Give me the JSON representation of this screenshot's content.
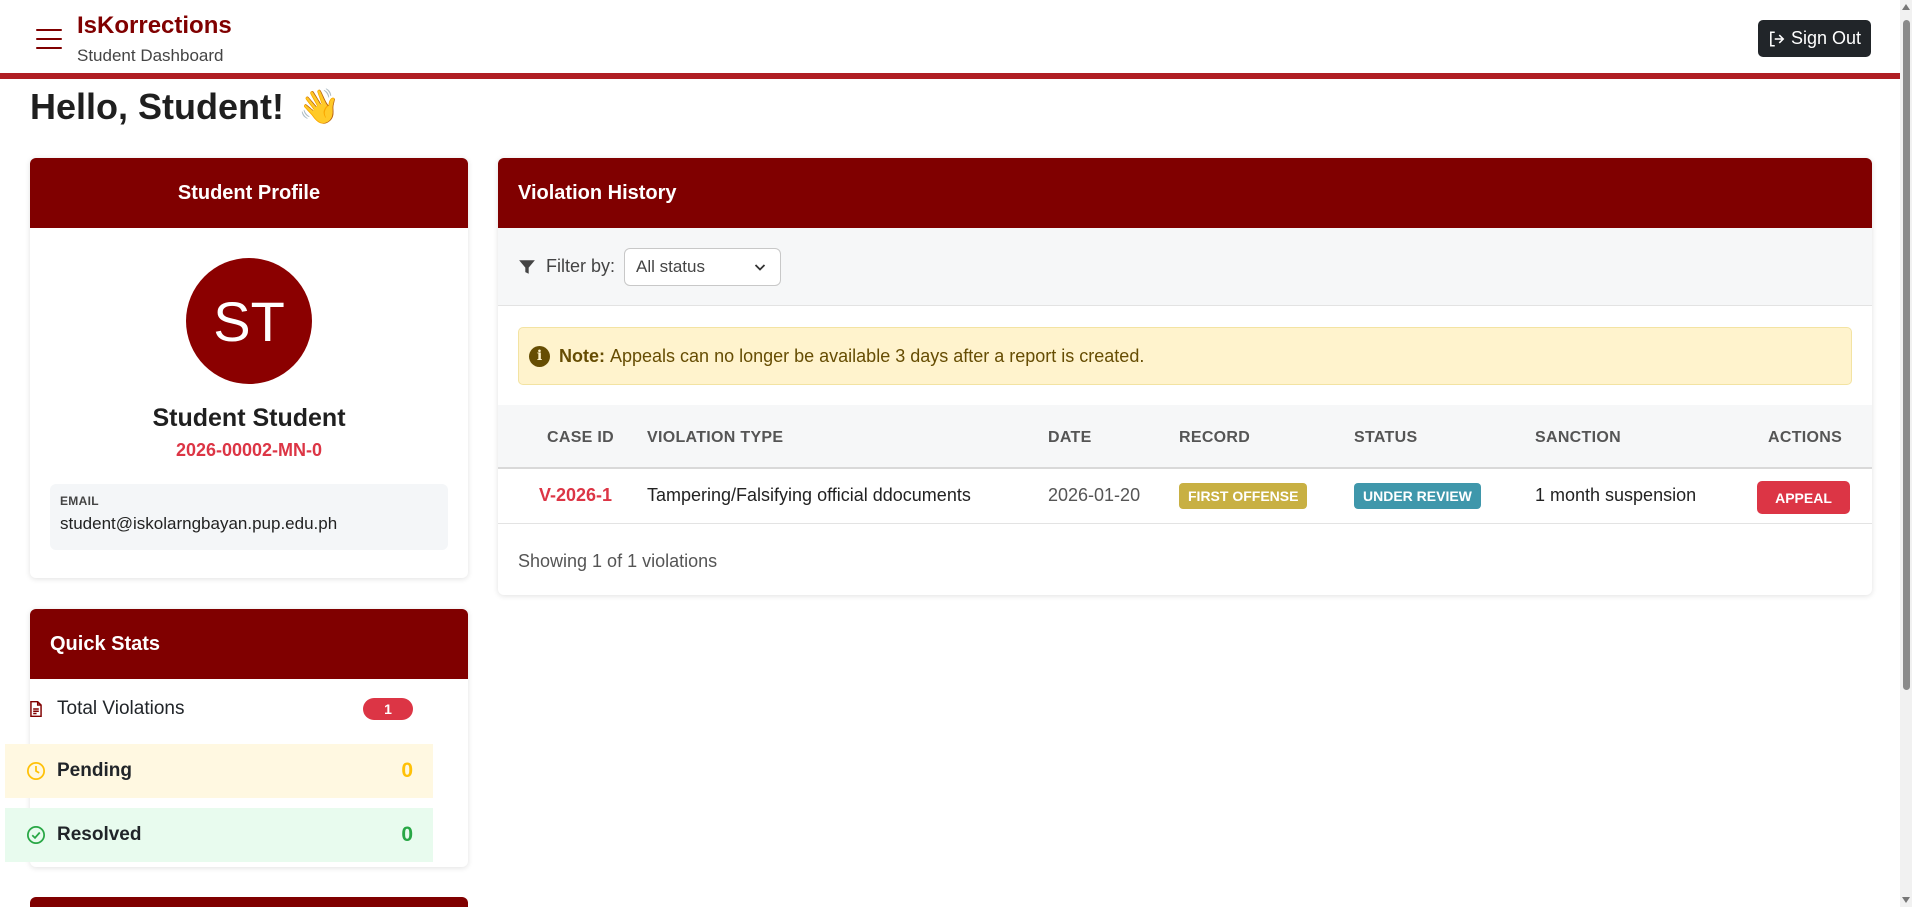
{
  "header": {
    "app_title": "IsKorrections",
    "subtitle": "Student Dashboard",
    "signout_label": "Sign Out"
  },
  "greeting": {
    "text": "Hello, Student!",
    "emoji": "👋"
  },
  "profile": {
    "title": "Student Profile",
    "initials": "ST",
    "name": "Student Student",
    "student_id": "2026-00002-MN-0",
    "email_label": "EMAIL",
    "email": "student@iskolarngbayan.pup.edu.ph"
  },
  "stats": {
    "title": "Quick Stats",
    "total_label": "Total Violations",
    "total_value": "1",
    "pending_label": "Pending",
    "pending_value": "0",
    "resolved_label": "Resolved",
    "resolved_value": "0"
  },
  "history": {
    "title": "Violation History",
    "filter_label": "Filter by:",
    "filter_value": "All status",
    "note_bold": "Note:",
    "note_text": "Appeals can no longer be available 3 days after a report is created.",
    "columns": [
      "CASE ID",
      "VIOLATION TYPE",
      "DATE",
      "RECORD",
      "STATUS",
      "SANCTION",
      "ACTIONS"
    ],
    "rows": [
      {
        "case_id": "V-2026-1",
        "violation_type": "Tampering/Falsifying official ddocuments",
        "date": "2026-01-20",
        "record": "FIRST OFFENSE",
        "status": "UNDER REVIEW",
        "sanction": "1 month suspension",
        "action": "APPEAL"
      }
    ],
    "showing": "Showing 1 of 1 violations"
  },
  "colors": {
    "brand": "#800000",
    "danger": "#dc3545",
    "warning": "#ffc107",
    "success": "#28a745",
    "record_badge": "#c8b043",
    "status_badge": "#3f97ab"
  },
  "icons": {
    "menu": "hamburger-icon",
    "signout": "sign-out-icon",
    "filter": "filter-icon",
    "info": "info-icon",
    "total": "document-icon",
    "pending": "clock-icon",
    "resolved": "check-circle-icon"
  }
}
